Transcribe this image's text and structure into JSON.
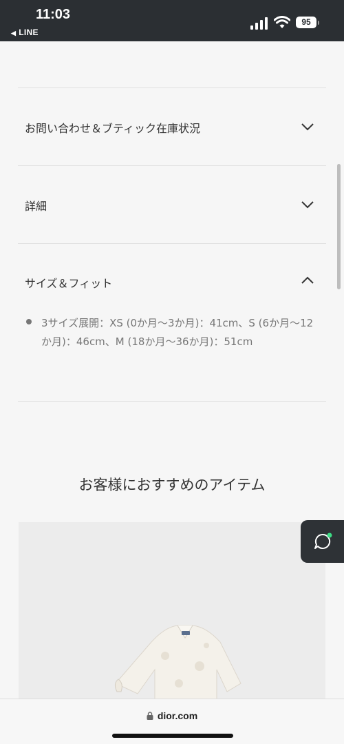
{
  "status_bar": {
    "time": "11:03",
    "back_app": "LINE",
    "battery": "95",
    "icons": [
      "cellular-signal-icon",
      "wifi-icon",
      "battery-icon"
    ]
  },
  "accordion": {
    "items": [
      {
        "label": "お問い合わせ＆ブティック在庫状況",
        "state": "collapsed",
        "icon": "chevron-down-icon"
      },
      {
        "label": "詳細",
        "state": "collapsed",
        "icon": "chevron-down-icon"
      },
      {
        "label": "サイズ＆フィット",
        "state": "expanded",
        "icon": "chevron-up-icon",
        "content": "3サイズ展開：XS (0か月〜3か月)：41cm、S (6か月〜12か月)：46cm、M (18か月〜36か月)：51cm"
      }
    ]
  },
  "recommendations": {
    "title": "お客様におすすめのアイテム"
  },
  "chat": {
    "icon": "chat-bubble-icon",
    "status_color": "#3ddc84"
  },
  "browser": {
    "url": "dior.com",
    "icon": "lock-icon"
  },
  "colors": {
    "status_bar_bg": "#2b2f33",
    "page_bg": "#f6f6f6",
    "text": "#333333",
    "muted": "#777777"
  }
}
